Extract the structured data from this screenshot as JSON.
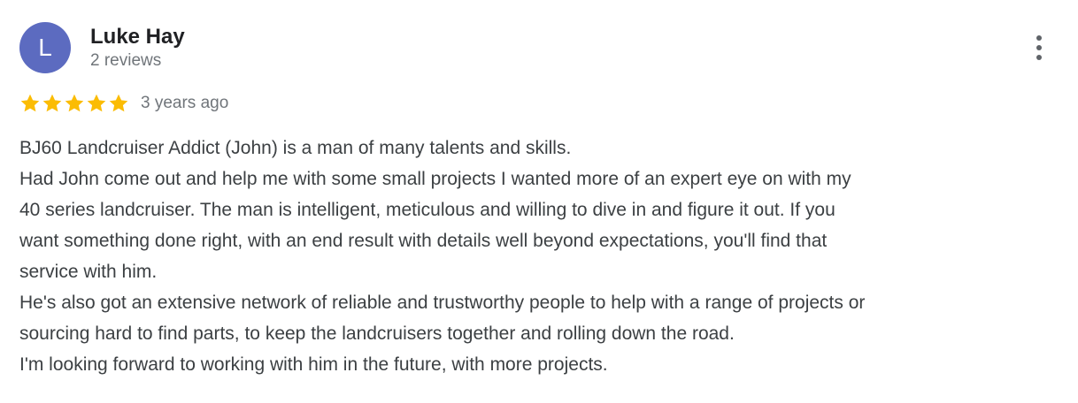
{
  "reviewer": {
    "initial": "L",
    "name": "Luke Hay",
    "reviews_count": "2 reviews",
    "avatar_color": "#5c6bc0"
  },
  "rating": {
    "stars": 5,
    "max_stars": 5,
    "star_color": "#fbbc04",
    "date": "3 years ago"
  },
  "menu": {
    "icon": "more-vert-icon"
  },
  "review": {
    "lines": [
      "BJ60 Landcruiser Addict (John) is a man of many talents and skills.",
      "Had John come out and help me with some small projects I wanted more of an expert eye on with my",
      "40 series landcruiser. The man is intelligent, meticulous and willing to dive in and figure it out. If you",
      "want something done right, with an end result with details well beyond expectations, you'll find that",
      "service with him.",
      "He's also got an extensive network of reliable and trustworthy people to help with a range of projects or",
      "sourcing hard to find parts, to keep the landcruisers together and rolling down the road.",
      "I'm looking forward to working with him in the future, with more projects."
    ]
  }
}
